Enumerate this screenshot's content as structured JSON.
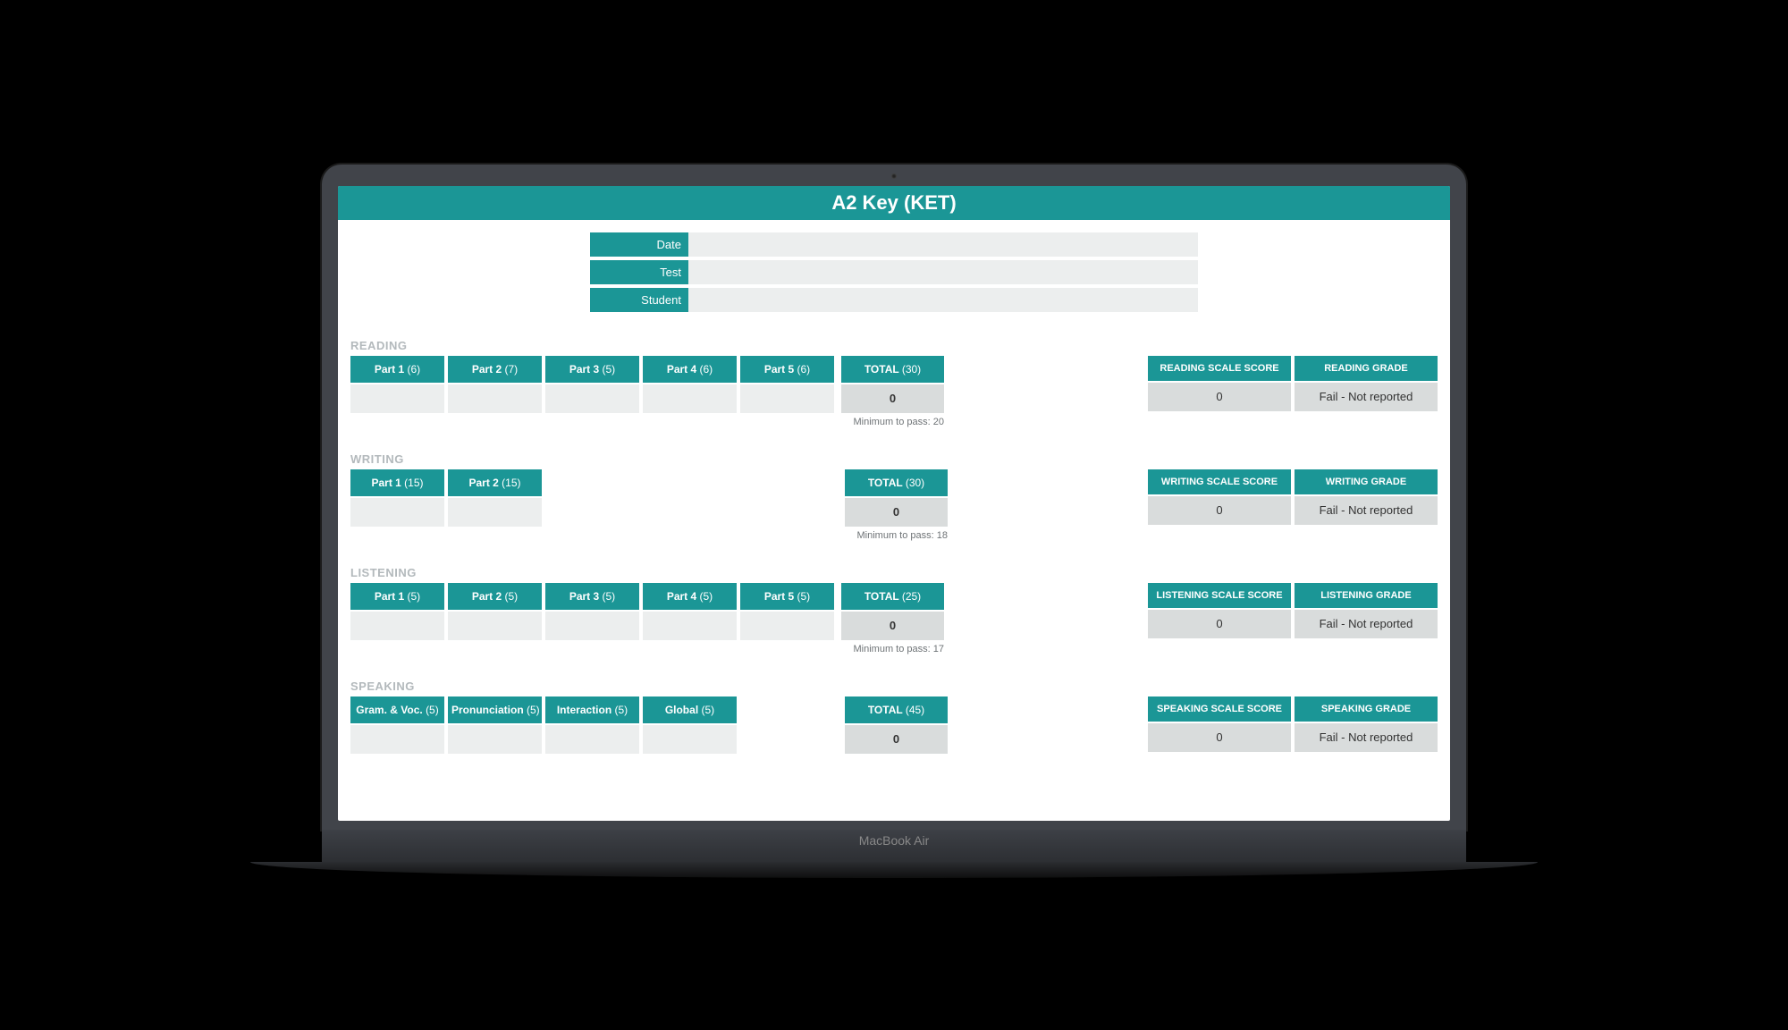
{
  "device_label": "MacBook Air",
  "title": "A2 Key (KET)",
  "meta": {
    "date_label": "Date",
    "date_value": "",
    "test_label": "Test",
    "test_value": "",
    "student_label": "Student",
    "student_value": ""
  },
  "sections": {
    "reading": {
      "label": "READING",
      "parts": [
        {
          "name": "Part 1",
          "max": "(6)",
          "value": ""
        },
        {
          "name": "Part 2",
          "max": "(7)",
          "value": ""
        },
        {
          "name": "Part 3",
          "max": "(5)",
          "value": ""
        },
        {
          "name": "Part 4",
          "max": "(6)",
          "value": ""
        },
        {
          "name": "Part 5",
          "max": "(6)",
          "value": ""
        }
      ],
      "total_label": "TOTAL",
      "total_max": "(30)",
      "total_value": "0",
      "min_pass": "Minimum to pass: 20",
      "scale_label": "READING SCALE SCORE",
      "scale_value": "0",
      "grade_label": "READING GRADE",
      "grade_value": "Fail - Not reported"
    },
    "writing": {
      "label": "WRITING",
      "parts": [
        {
          "name": "Part 1",
          "max": "(15)",
          "value": ""
        },
        {
          "name": "Part 2",
          "max": "(15)",
          "value": ""
        }
      ],
      "total_label": "TOTAL",
      "total_max": "(30)",
      "total_value": "0",
      "min_pass": "Minimum to pass: 18",
      "scale_label": "WRITING SCALE SCORE",
      "scale_value": "0",
      "grade_label": "WRITING GRADE",
      "grade_value": "Fail - Not reported"
    },
    "listening": {
      "label": "LISTENING",
      "parts": [
        {
          "name": "Part 1",
          "max": "(5)",
          "value": ""
        },
        {
          "name": "Part 2",
          "max": "(5)",
          "value": ""
        },
        {
          "name": "Part 3",
          "max": "(5)",
          "value": ""
        },
        {
          "name": "Part 4",
          "max": "(5)",
          "value": ""
        },
        {
          "name": "Part 5",
          "max": "(5)",
          "value": ""
        }
      ],
      "total_label": "TOTAL",
      "total_max": "(25)",
      "total_value": "0",
      "min_pass": "Minimum to pass: 17",
      "scale_label": "LISTENING SCALE SCORE",
      "scale_value": "0",
      "grade_label": "LISTENING GRADE",
      "grade_value": "Fail - Not reported"
    },
    "speaking": {
      "label": "SPEAKING",
      "parts": [
        {
          "name": "Gram. & Voc.",
          "max": "(5)",
          "value": ""
        },
        {
          "name": "Pronunciation",
          "max": "(5)",
          "value": ""
        },
        {
          "name": "Interaction",
          "max": "(5)",
          "value": ""
        },
        {
          "name": "Global",
          "max": "(5)",
          "value": ""
        }
      ],
      "total_label": "TOTAL",
      "total_max": "(45)",
      "total_value": "0",
      "min_pass": "",
      "scale_label": "SPEAKING SCALE SCORE",
      "scale_value": "0",
      "grade_label": "SPEAKING GRADE",
      "grade_value": "Fail - Not reported"
    }
  }
}
